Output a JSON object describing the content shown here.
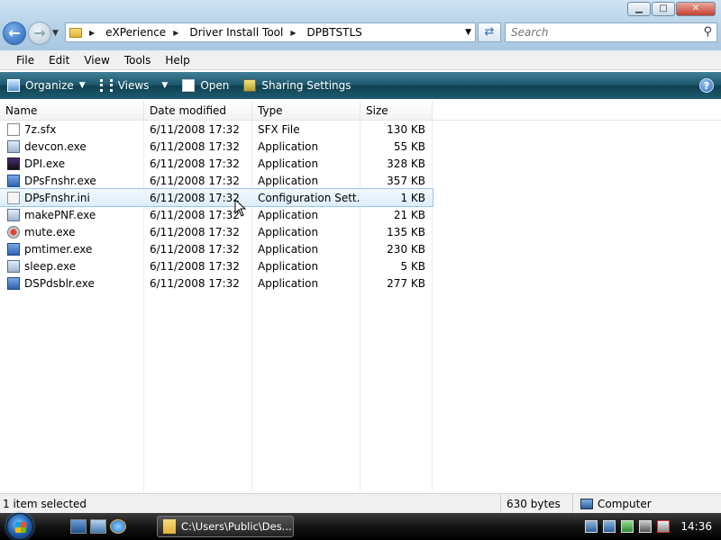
{
  "window": {
    "minimize_glyph": "▁",
    "maximize_glyph": "□",
    "close_glyph": "✕"
  },
  "address": {
    "crumbs": [
      "eXPerience",
      "Driver Install Tool",
      "DPBTSTLS"
    ],
    "search_placeholder": "Search"
  },
  "menu": [
    "File",
    "Edit",
    "View",
    "Tools",
    "Help"
  ],
  "commands": {
    "organize": "Organize",
    "views": "Views",
    "open": "Open",
    "sharing": "Sharing Settings"
  },
  "columns": {
    "name": "Name",
    "date": "Date modified",
    "type": "Type",
    "size": "Size"
  },
  "files": [
    {
      "name": "7z.sfx",
      "date": "6/11/2008 17:32",
      "type": "SFX File",
      "size": "130 KB",
      "icon": "doc-icon"
    },
    {
      "name": "devcon.exe",
      "date": "6/11/2008 17:32",
      "type": "Application",
      "size": "55 KB",
      "icon": "app-icon"
    },
    {
      "name": "DPI.exe",
      "date": "6/11/2008 17:32",
      "type": "Application",
      "size": "328 KB",
      "icon": "dpi-icon"
    },
    {
      "name": "DPsFnshr.exe",
      "date": "6/11/2008 17:32",
      "type": "Application",
      "size": "357 KB",
      "icon": "dps-icon"
    },
    {
      "name": "DPsFnshr.ini",
      "date": "6/11/2008 17:32",
      "type": "Configuration Sett...",
      "size": "1 KB",
      "icon": "ini-icon"
    },
    {
      "name": "makePNF.exe",
      "date": "6/11/2008 17:32",
      "type": "Application",
      "size": "21 KB",
      "icon": "app-icon"
    },
    {
      "name": "mute.exe",
      "date": "6/11/2008 17:32",
      "type": "Application",
      "size": "135 KB",
      "icon": "mute-icon"
    },
    {
      "name": "pmtimer.exe",
      "date": "6/11/2008 17:32",
      "type": "Application",
      "size": "230 KB",
      "icon": "dps-icon"
    },
    {
      "name": "sleep.exe",
      "date": "6/11/2008 17:32",
      "type": "Application",
      "size": "5 KB",
      "icon": "app-icon"
    },
    {
      "name": "DSPdsblr.exe",
      "date": "6/11/2008 17:32",
      "type": "Application",
      "size": "277 KB",
      "icon": "dps-icon"
    }
  ],
  "selected_index": 4,
  "status": {
    "selection": "1 item selected",
    "size": "630 bytes",
    "zone": "Computer"
  },
  "taskbar": {
    "task_label": "C:\\Users\\Public\\Des...",
    "clock": "14:36"
  }
}
